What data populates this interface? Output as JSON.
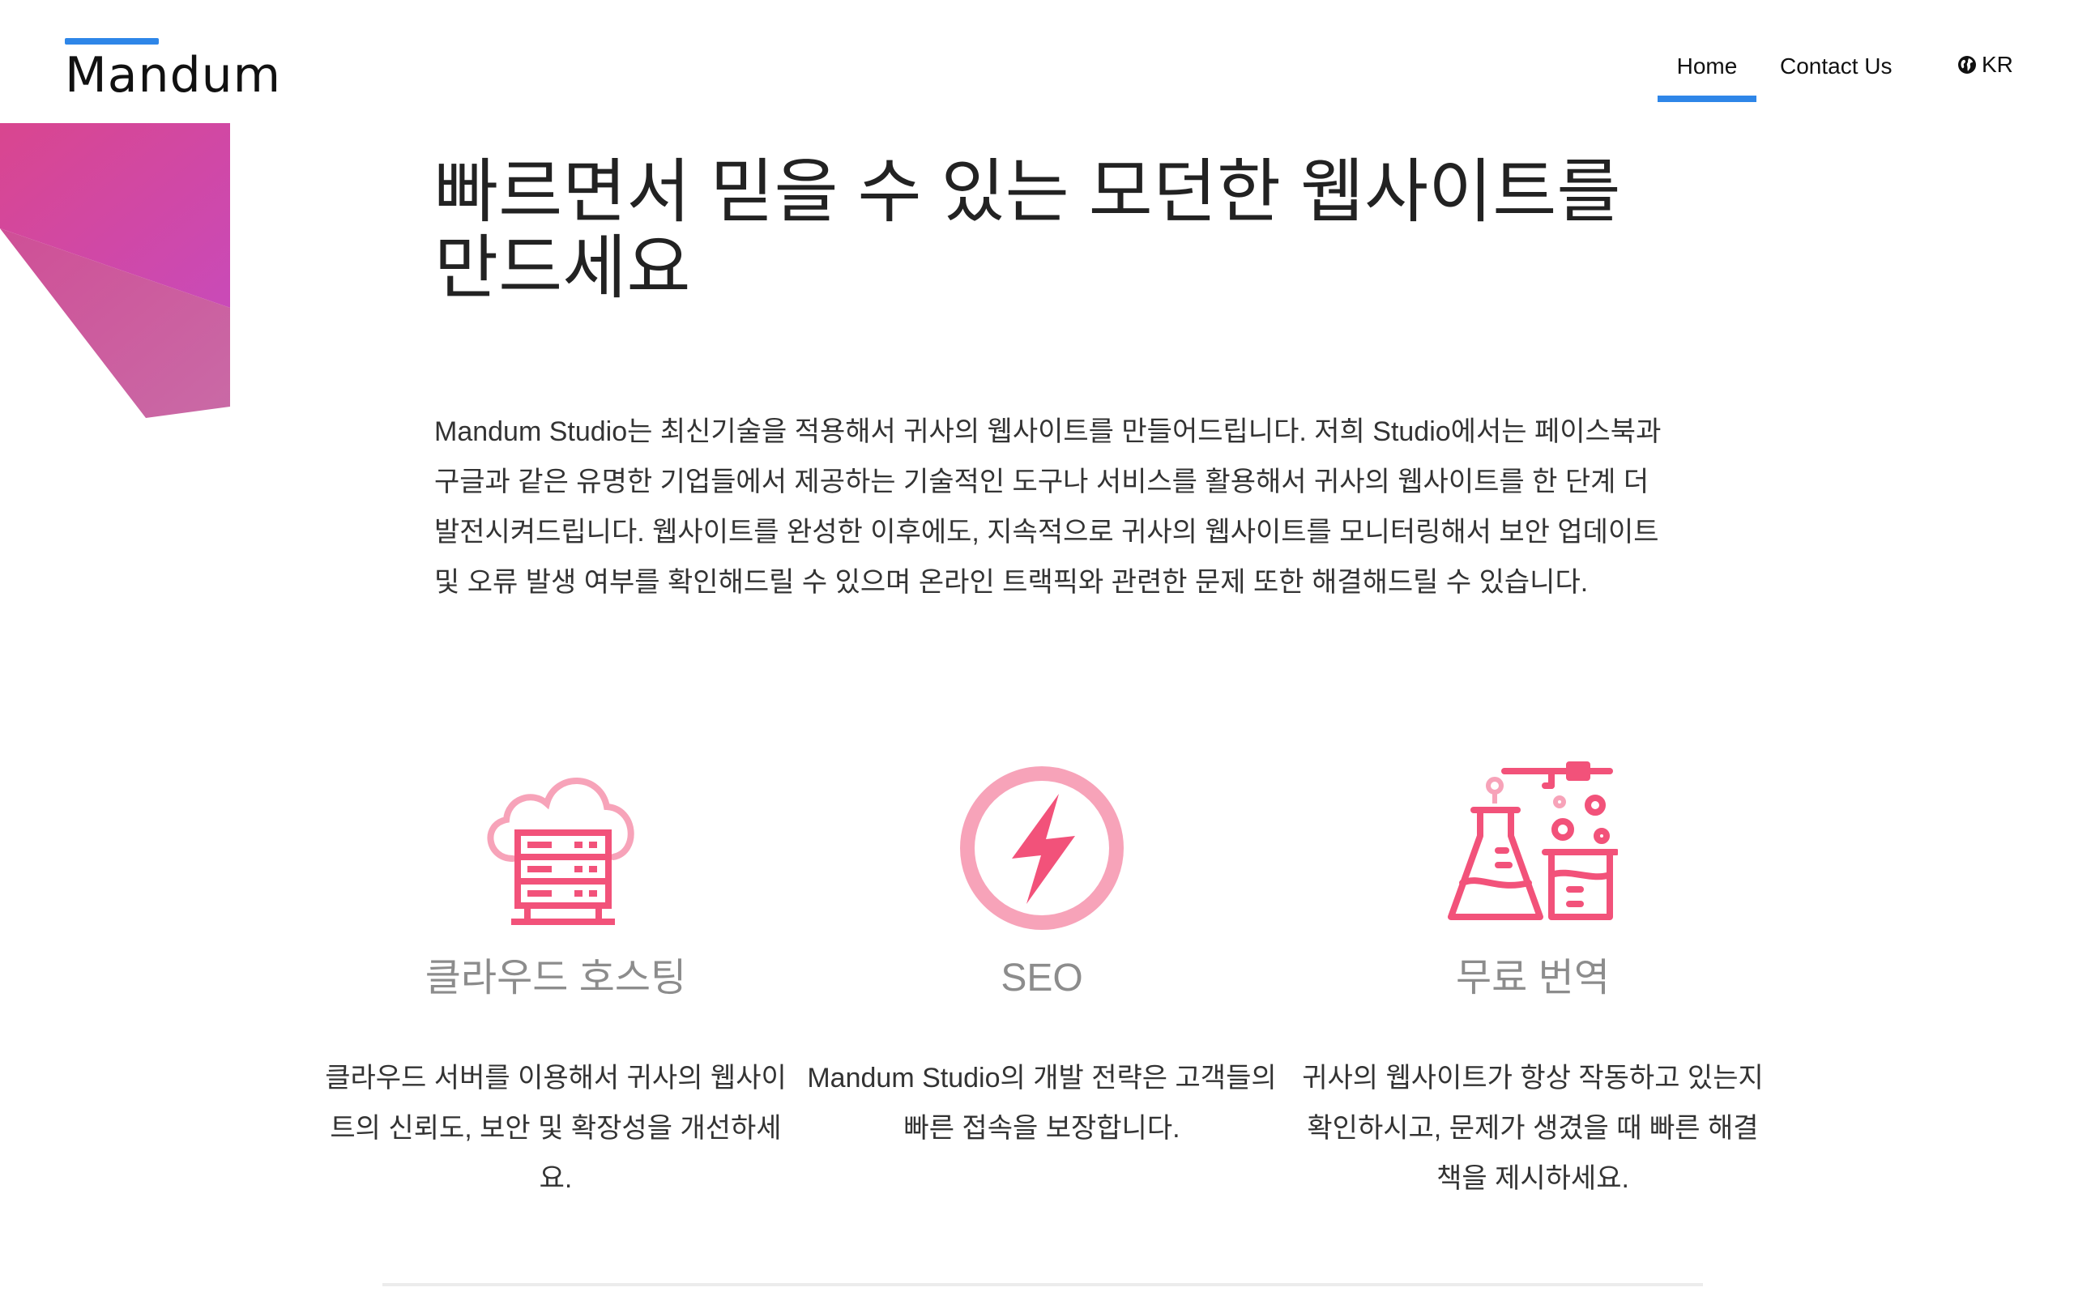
{
  "brand": {
    "logo_text": "Mandum",
    "accent_color": "#2e86e8",
    "icon_color": "#f2527a",
    "icon_light_color": "#f7a3b9"
  },
  "nav": {
    "home": "Home",
    "contact": "Contact Us",
    "language": "KR",
    "active": "Home"
  },
  "hero": {
    "title": "빠르면서 믿을 수 있는 모던한 웹사이트를 만드세요",
    "description": "Mandum Studio는 최신기술을 적용해서 귀사의 웹사이트를 만들어드립니다. 저희 Studio에서는 페이스북과 구글과 같은 유명한 기업들에서 제공하는 기술적인 도구나 서비스를 활용해서 귀사의 웹사이트를 한 단계 더 발전시켜드립니다. 웹사이트를 완성한 이후에도, 지속적으로 귀사의 웹사이트를 모니터링해서 보안 업데이트 및 오류 발생 여부를 확인해드릴 수 있으며 온라인 트랙픽와 관련한 문제 또한 해결해드릴 수 있습니다."
  },
  "features": [
    {
      "icon": "cloud-server-icon",
      "title": "클라우드 호스팅",
      "description": "클라우드 서버를 이용해서 귀사의 웹사이트의 신뢰도, 보안 및 확장성을 개선하세요."
    },
    {
      "icon": "lightning-bolt-icon",
      "title": "SEO",
      "description": "Mandum Studio의 개발 전략은 고객들의 빠른 접속을 보장합니다."
    },
    {
      "icon": "lab-flask-icon",
      "title": "무료 번역",
      "description": "귀사의 웹사이트가 항상 작동하고 있는지 확인하시고, 문제가 생겼을 때 빠른 해결책을 제시하세요."
    }
  ]
}
